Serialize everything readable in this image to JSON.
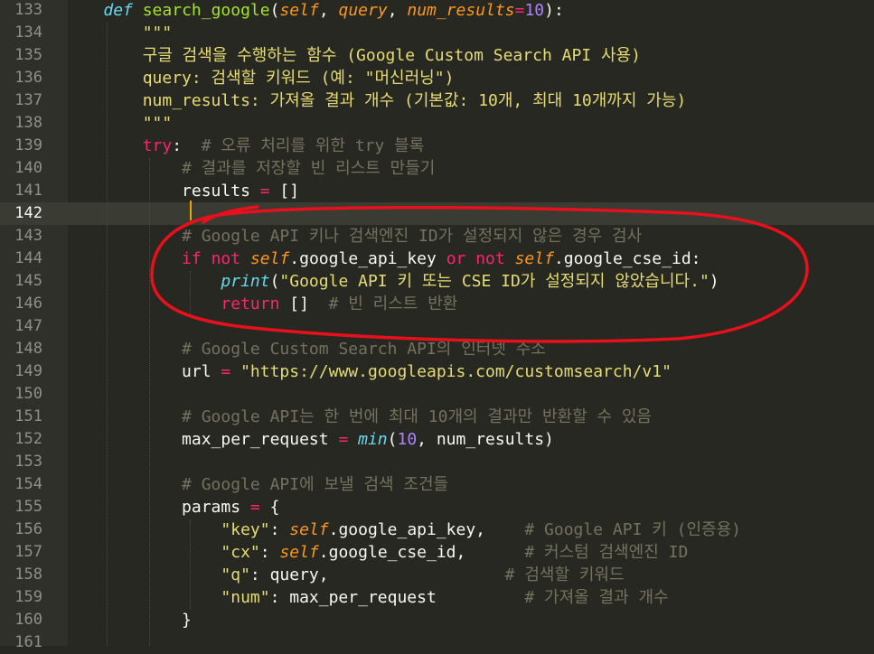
{
  "editor": {
    "current_line": 142,
    "lines": [
      {
        "n": 133,
        "tokens": [
          [
            "pl",
            "    "
          ],
          [
            "kwi",
            "def"
          ],
          [
            "pl",
            " "
          ],
          [
            "fn",
            "search_google"
          ],
          [
            "pl",
            "("
          ],
          [
            "pa",
            "self"
          ],
          [
            "pl",
            ", "
          ],
          [
            "pa",
            "query"
          ],
          [
            "pl",
            ", "
          ],
          [
            "pa",
            "num_results"
          ],
          [
            "kw",
            "="
          ],
          [
            "num",
            "10"
          ],
          [
            "pl",
            "):"
          ]
        ]
      },
      {
        "n": 134,
        "tokens": [
          [
            "pl",
            "        "
          ],
          [
            "str",
            "\"\"\""
          ]
        ]
      },
      {
        "n": 135,
        "tokens": [
          [
            "pl",
            "        "
          ],
          [
            "str",
            "구글 검색을 수행하는 함수 (Google Custom Search API 사용)"
          ]
        ]
      },
      {
        "n": 136,
        "tokens": [
          [
            "pl",
            "        "
          ],
          [
            "str",
            "query: 검색할 키워드 (예: \"머신러닝\")"
          ]
        ]
      },
      {
        "n": 137,
        "tokens": [
          [
            "pl",
            "        "
          ],
          [
            "str",
            "num_results: 가져올 결과 개수 (기본값: 10개, 최대 10개까지 가능)"
          ]
        ]
      },
      {
        "n": 138,
        "tokens": [
          [
            "pl",
            "        "
          ],
          [
            "str",
            "\"\"\""
          ]
        ]
      },
      {
        "n": 139,
        "tokens": [
          [
            "pl",
            "        "
          ],
          [
            "kw",
            "try"
          ],
          [
            "pl",
            ":  "
          ],
          [
            "cm",
            "# 오류 처리를 위한 try 블록"
          ]
        ]
      },
      {
        "n": 140,
        "tokens": [
          [
            "pl",
            "            "
          ],
          [
            "cm",
            "# 결과를 저장할 빈 리스트 만들기"
          ]
        ]
      },
      {
        "n": 141,
        "tokens": [
          [
            "pl",
            "            results "
          ],
          [
            "kw",
            "="
          ],
          [
            "pl",
            " []"
          ]
        ]
      },
      {
        "n": 142,
        "tokens": [
          [
            "pl",
            "            "
          ]
        ]
      },
      {
        "n": 143,
        "tokens": [
          [
            "pl",
            "            "
          ],
          [
            "cm",
            "# Google API 키나 검색엔진 ID가 설정되지 않은 경우 검사"
          ]
        ]
      },
      {
        "n": 144,
        "tokens": [
          [
            "pl",
            "            "
          ],
          [
            "kw",
            "if"
          ],
          [
            "pl",
            " "
          ],
          [
            "kw",
            "not"
          ],
          [
            "pl",
            " "
          ],
          [
            "self",
            "self"
          ],
          [
            "pl",
            ".google_api_key "
          ],
          [
            "kw",
            "or"
          ],
          [
            "pl",
            " "
          ],
          [
            "kw",
            "not"
          ],
          [
            "pl",
            " "
          ],
          [
            "self",
            "self"
          ],
          [
            "pl",
            ".google_cse_id:"
          ]
        ]
      },
      {
        "n": 145,
        "tokens": [
          [
            "pl",
            "                "
          ],
          [
            "bi",
            "print"
          ],
          [
            "pl",
            "("
          ],
          [
            "str",
            "\"Google API 키 또는 CSE ID가 설정되지 않았습니다.\""
          ],
          [
            "pl",
            ")"
          ]
        ]
      },
      {
        "n": 146,
        "tokens": [
          [
            "pl",
            "                "
          ],
          [
            "kw",
            "return"
          ],
          [
            "pl",
            " []  "
          ],
          [
            "cm",
            "# 빈 리스트 반환"
          ]
        ]
      },
      {
        "n": 147,
        "tokens": []
      },
      {
        "n": 148,
        "tokens": [
          [
            "pl",
            "            "
          ],
          [
            "cm",
            "# Google Custom Search API의 인터넷 주소"
          ]
        ]
      },
      {
        "n": 149,
        "tokens": [
          [
            "pl",
            "            url "
          ],
          [
            "kw",
            "="
          ],
          [
            "pl",
            " "
          ],
          [
            "str",
            "\"https://www.googleapis.com/customsearch/v1\""
          ]
        ]
      },
      {
        "n": 150,
        "tokens": []
      },
      {
        "n": 151,
        "tokens": [
          [
            "pl",
            "            "
          ],
          [
            "cm",
            "# Google API는 한 번에 최대 10개의 결과만 반환할 수 있음"
          ]
        ]
      },
      {
        "n": 152,
        "tokens": [
          [
            "pl",
            "            max_per_request "
          ],
          [
            "kw",
            "="
          ],
          [
            "pl",
            " "
          ],
          [
            "bi",
            "min"
          ],
          [
            "pl",
            "("
          ],
          [
            "num",
            "10"
          ],
          [
            "pl",
            ", num_results)"
          ]
        ]
      },
      {
        "n": 153,
        "tokens": []
      },
      {
        "n": 154,
        "tokens": [
          [
            "pl",
            "            "
          ],
          [
            "cm",
            "# Google API에 보낼 검색 조건들"
          ]
        ]
      },
      {
        "n": 155,
        "tokens": [
          [
            "pl",
            "            params "
          ],
          [
            "kw",
            "="
          ],
          [
            "pl",
            " {"
          ]
        ]
      },
      {
        "n": 156,
        "tokens": [
          [
            "pl",
            "                "
          ],
          [
            "str",
            "\"key\""
          ],
          [
            "pl",
            ": "
          ],
          [
            "self",
            "self"
          ],
          [
            "pl",
            ".google_api_key,    "
          ],
          [
            "cm",
            "# Google API 키 (인증용)"
          ]
        ]
      },
      {
        "n": 157,
        "tokens": [
          [
            "pl",
            "                "
          ],
          [
            "str",
            "\"cx\""
          ],
          [
            "pl",
            ": "
          ],
          [
            "self",
            "self"
          ],
          [
            "pl",
            ".google_cse_id,      "
          ],
          [
            "cm",
            "# 커스텀 검색엔진 ID"
          ]
        ]
      },
      {
        "n": 158,
        "tokens": [
          [
            "pl",
            "                "
          ],
          [
            "str",
            "\"q\""
          ],
          [
            "pl",
            ": query,                  "
          ],
          [
            "cm",
            "# 검색할 키워드"
          ]
        ]
      },
      {
        "n": 159,
        "tokens": [
          [
            "pl",
            "                "
          ],
          [
            "str",
            "\"num\""
          ],
          [
            "pl",
            ": max_per_request         "
          ],
          [
            "cm",
            "# 가져올 결과 개수"
          ]
        ]
      },
      {
        "n": 160,
        "tokens": [
          [
            "pl",
            "            }"
          ]
        ]
      },
      {
        "n": 161,
        "tokens": []
      }
    ]
  },
  "annotation": {
    "color": "#e8101a",
    "shape": "freehand-ellipse"
  }
}
